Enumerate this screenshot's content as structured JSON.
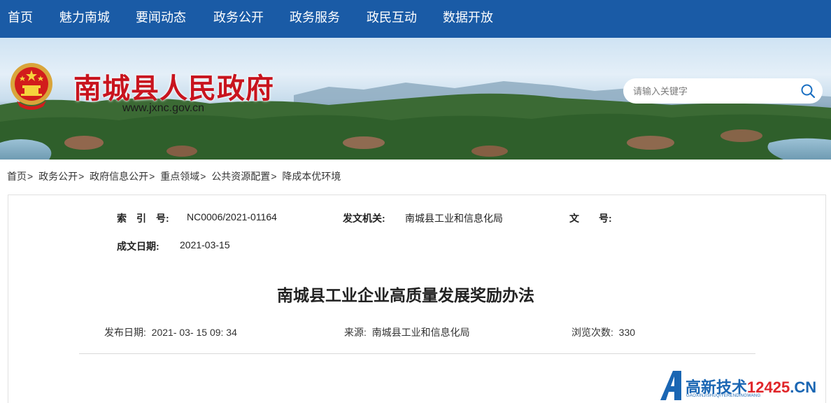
{
  "nav": {
    "items": [
      "首页",
      "魅力南城",
      "要闻动态",
      "政务公开",
      "政务服务",
      "政民互动",
      "数据开放"
    ]
  },
  "header": {
    "site_title": "南城县人民政府",
    "site_url": "www.jxnc.gov.cn",
    "search_placeholder": "请输入关键字",
    "icons": [
      "national-emblem",
      "search-icon"
    ]
  },
  "breadcrumb": [
    "首页",
    "政务公开",
    "政府信息公开",
    "重点领域",
    "公共资源配置",
    "降成本优环境"
  ],
  "breadcrumb_separator": ">",
  "doc_meta": {
    "index_label": "索　引　号:",
    "index_value": "NC0006/2021-01164",
    "issuer_label": "发文机关:",
    "issuer_value": "南城县工业和信息化局",
    "docno_label": "文　　号:",
    "docno_value": "",
    "date_label": "成文日期:",
    "date_value": "2021-03-15"
  },
  "article": {
    "title": "南城县工业企业高质量发展奖励办法",
    "publish_label": "发布日期:",
    "publish_value": "2021- 03- 15 09: 34",
    "source_label": "来源:",
    "source_value": "南城县工业和信息化局",
    "views_label": "浏览次数:",
    "views_value": "330"
  },
  "watermark": {
    "text_prefix": "高新技术",
    "text_number": "12425",
    "text_suffix": ".CN",
    "sub": "GAOXINJISHUQIYERENDINGWANG"
  },
  "colors": {
    "nav_bg": "#1a5ba6",
    "title_red": "#c8141e",
    "watermark_blue": "#1a66b3"
  }
}
